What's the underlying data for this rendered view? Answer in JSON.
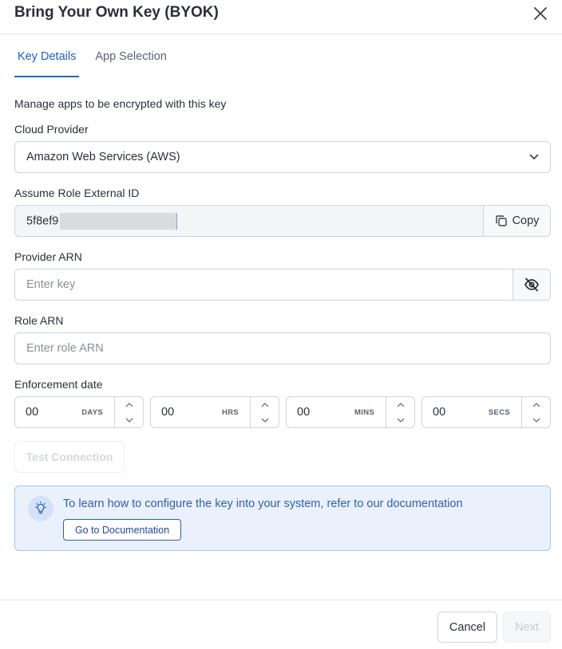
{
  "dialog": {
    "title": "Bring Your Own Key (BYOK)",
    "close_icon": "close-icon"
  },
  "tabs": [
    {
      "label": "Key Details",
      "active": true
    },
    {
      "label": "App Selection",
      "active": false
    }
  ],
  "description": "Manage apps to be encrypted with this key",
  "cloud_provider": {
    "label": "Cloud Provider",
    "value": "Amazon Web Services (AWS)",
    "icon": "chevron-down-icon"
  },
  "external_id": {
    "label": "Assume Role External ID",
    "value_visible": "5f8ef9",
    "copy_label": "Copy",
    "copy_icon": "copy-icon"
  },
  "provider_arn": {
    "label": "Provider ARN",
    "placeholder": "Enter key",
    "toggle_icon": "eye-off-icon"
  },
  "role_arn": {
    "label": "Role ARN",
    "placeholder": "Enter role ARN"
  },
  "enforcement": {
    "label": "Enforcement date",
    "fields": [
      {
        "value": "00",
        "unit": "DAYS"
      },
      {
        "value": "00",
        "unit": "HRS"
      },
      {
        "value": "00",
        "unit": "MINS"
      },
      {
        "value": "00",
        "unit": "SECS"
      }
    ]
  },
  "test_connection_label": "Test Connection",
  "info": {
    "icon": "lightbulb-icon",
    "text": "To learn how to configure the key into your system, refer to our documentation",
    "button_label": "Go to Documentation"
  },
  "footer": {
    "cancel_label": "Cancel",
    "next_label": "Next"
  },
  "colors": {
    "accent": "#2563c9",
    "info_bg": "#eaf1fd",
    "info_border": "#a9c4ef"
  }
}
